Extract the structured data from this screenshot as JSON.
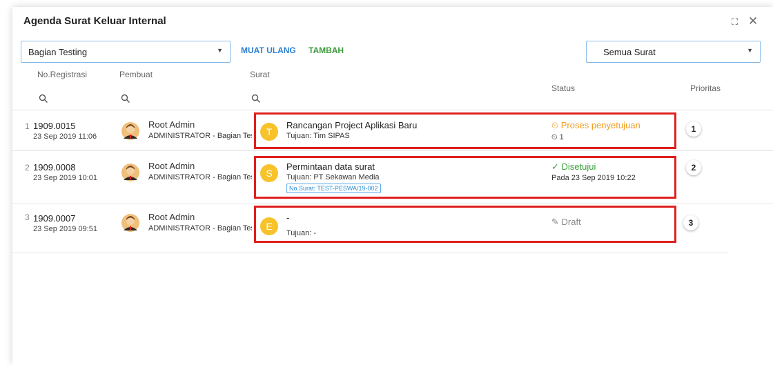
{
  "window": {
    "title": "Agenda Surat Keluar Internal"
  },
  "icons": {
    "expand": "expand-icon",
    "close": "close-icon",
    "search": "search-icon",
    "timer": "timer-icon",
    "check": "check-icon",
    "pencil": "pencil-icon",
    "caret": "caret-down-icon"
  },
  "toolbar": {
    "unit_select": "Bagian Testing",
    "reload_label": "MUAT ULANG",
    "add_label": "TAMBAH",
    "filter_select": "Semua Surat"
  },
  "columns": {
    "registration": "No.Registrasi",
    "maker": "Pembuat",
    "letter": "Surat",
    "status": "Status",
    "priority": "Prioritas"
  },
  "colors": {
    "accent": "#2a7fd4",
    "add": "#3c9a3c",
    "pending": "#f39a1a",
    "approved": "#3aa13a",
    "draft": "#888888",
    "highlight": "#e01f1f",
    "letter_avatar": "#f8c22a"
  },
  "rows": [
    {
      "index": "1",
      "reg": "1909.0015",
      "date": "23 Sep 2019 11:06",
      "maker_name": "Root Admin",
      "maker_role": "ADMINISTRATOR - Bagian Testing",
      "letter_initial": "T",
      "title": "Rancangan Project Aplikasi Baru",
      "to": "Tujuan: Tim SIPAS",
      "status": "Proses penyetujuan",
      "status_sub": "1",
      "priority": "1"
    },
    {
      "index": "2",
      "reg": "1909.0008",
      "date": "23 Sep 2019 10:01",
      "maker_name": "Root Admin",
      "maker_role": "ADMINISTRATOR - Bagian Testing",
      "letter_initial": "S",
      "title": "Permintaan data surat",
      "to": "Tujuan: PT Sekawan Media",
      "letter_no": "No.Surat: TEST-PESWA/19-002",
      "status": "Disetujui",
      "status_sub": "Pada 23 Sep 2019 10:22",
      "priority": "2"
    },
    {
      "index": "3",
      "reg": "1909.0007",
      "date": "23 Sep 2019 09:51",
      "maker_name": "Root Admin",
      "maker_role": "ADMINISTRATOR - Bagian Testing",
      "letter_initial": "E",
      "title": "-",
      "to": "Tujuan: -",
      "status": "Draft",
      "priority": "3"
    }
  ]
}
